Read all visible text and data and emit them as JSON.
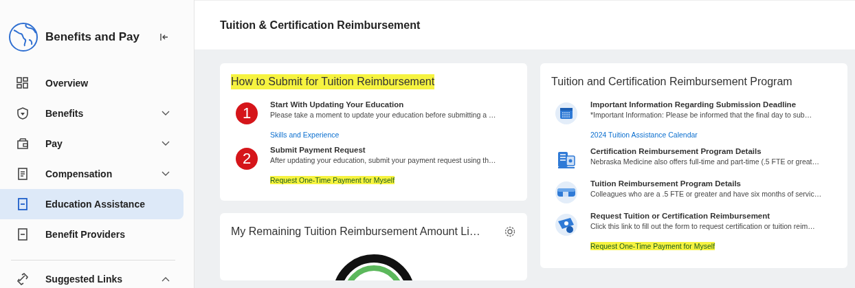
{
  "sidebar": {
    "title": "Benefits and Pay",
    "items": [
      {
        "label": "Overview",
        "expandable": false,
        "selected": false
      },
      {
        "label": "Benefits",
        "expandable": true,
        "expanded": false,
        "selected": false
      },
      {
        "label": "Pay",
        "expandable": true,
        "expanded": false,
        "selected": false
      },
      {
        "label": "Compensation",
        "expandable": true,
        "expanded": false,
        "selected": false
      },
      {
        "label": "Education Assistance",
        "expandable": false,
        "selected": true
      },
      {
        "label": "Benefit Providers",
        "expandable": false,
        "selected": false
      }
    ],
    "links_section": {
      "label": "Suggested Links",
      "expanded": true
    }
  },
  "page_title": "Tuition & Certification Reimbursement",
  "columns": [
    [
      {
        "kind": "steps",
        "title": "How to Submit for Tuition Reimbursement",
        "title_highlighted": true,
        "items": [
          {
            "number": "1",
            "title": "Start With Updating Your Education",
            "description": "Please take a moment to update your education before submitting a …",
            "link": {
              "text": "Skills and Experience",
              "highlighted": false
            }
          },
          {
            "number": "2",
            "title": "Submit Payment Request",
            "description": "After updating your education, submit your payment request using th…",
            "link": {
              "text": "Request One-Time Payment for Myself",
              "highlighted": true
            }
          }
        ]
      },
      {
        "kind": "gauge",
        "title": "My Remaining Tuition Reimbursement Amount Li…"
      }
    ],
    [
      {
        "kind": "program",
        "title": "Tuition and Certification Reimbursement Program",
        "title_highlighted": false,
        "items": [
          {
            "title": "Important Information Regarding Submission Deadline",
            "description": "*Important Information: Please be informed that the final day to sub…",
            "link": {
              "text": "2024 Tuition Assistance Calendar",
              "highlighted": false
            }
          },
          {
            "title": "Certification Reimbursement Program Details",
            "description": "Nebraska Medicine also offers full-time and part-time (.5 FTE or great…"
          },
          {
            "title": "Tuition Reimbursement Program Details",
            "description": "Colleagues who are a .5 FTE or greater and have six months of servic…"
          },
          {
            "title": "Request Tuition or Certification Reimbursement",
            "description": "Click this link to fill out the form to request certification or tuition reim…",
            "link": {
              "text": "Request One-Time Payment for Myself",
              "highlighted": true
            }
          }
        ]
      }
    ]
  ]
}
